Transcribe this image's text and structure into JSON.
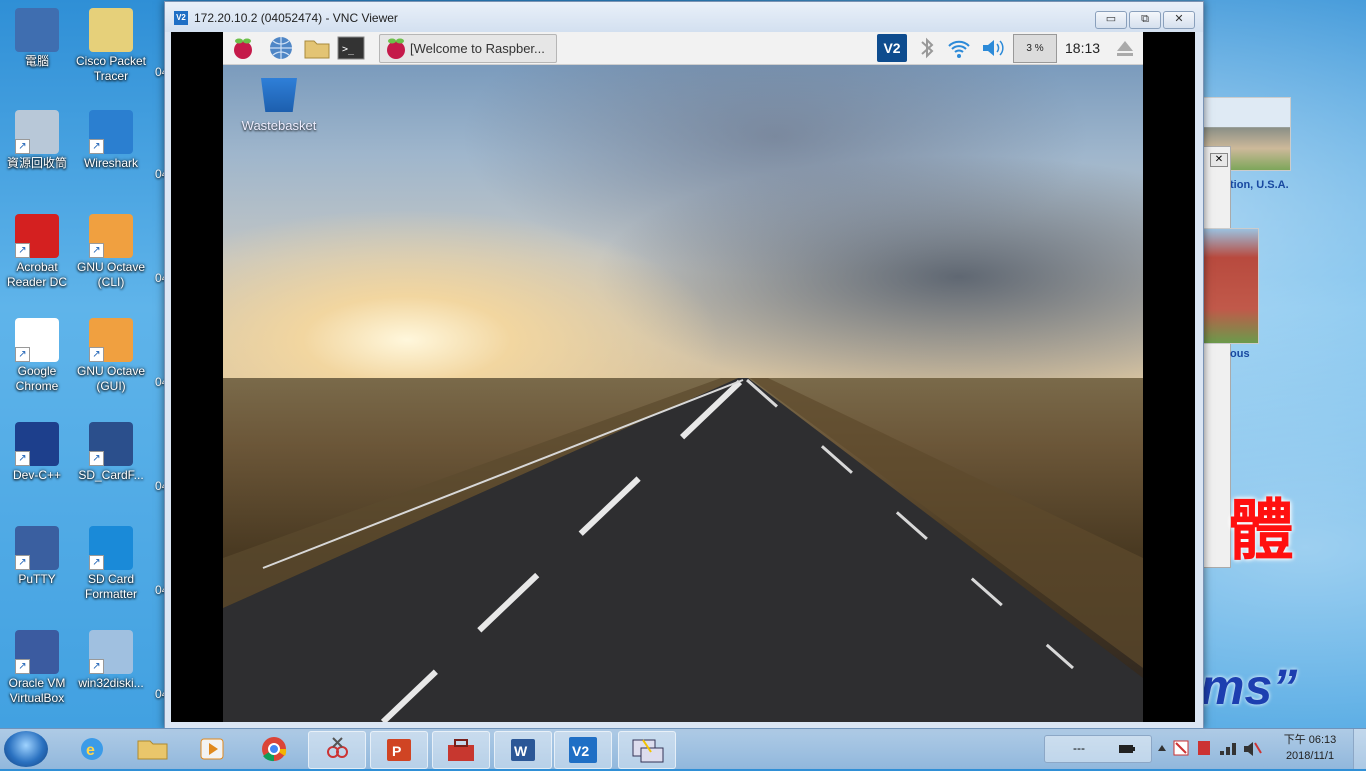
{
  "desktop": {
    "icons": [
      {
        "name": "computer-icon",
        "label": "電腦"
      },
      {
        "name": "cisco-packet-tracer-icon",
        "label": "Cisco Packet Tracer"
      },
      {
        "name": "recycle-bin-icon",
        "label": "資源回收筒"
      },
      {
        "name": "wireshark-icon",
        "label": "Wireshark"
      },
      {
        "name": "acrobat-reader-icon",
        "label": "Acrobat Reader DC"
      },
      {
        "name": "gnu-octave-cli-icon",
        "label": "GNU Octave (CLI)"
      },
      {
        "name": "google-chrome-icon",
        "label": "Google Chrome"
      },
      {
        "name": "gnu-octave-gui-icon",
        "label": "GNU Octave (GUI)"
      },
      {
        "name": "dev-cpp-icon",
        "label": "Dev-C++"
      },
      {
        "name": "sd-card-f-icon",
        "label": "SD_CardF..."
      },
      {
        "name": "putty-icon",
        "label": "PuTTY"
      },
      {
        "name": "sd-card-formatter-icon",
        "label": "SD Card Formatter"
      },
      {
        "name": "oracle-vm-virtualbox-icon",
        "label": "Oracle VM VirtualBox"
      },
      {
        "name": "win32diskimager-icon",
        "label": "win32diski..."
      }
    ],
    "truncated_label": "04",
    "bg_text": {
      "usa": "tion, U.S.A.",
      "campus": "ous",
      "big_red": "體",
      "big_blue": "ms”"
    }
  },
  "vnc": {
    "title": "172.20.10.2 (04052474) - VNC Viewer",
    "logo_text": "V2",
    "minimize": "▭",
    "restore": "⧉",
    "close": "✕"
  },
  "pi": {
    "task_label": "[Welcome to Raspber...",
    "vnc_label": "V2",
    "cpu": "3 %",
    "time": "18:13",
    "trash_label": "Wastebasket"
  },
  "taskbar": {
    "tray_text": "---",
    "clock_line1": "下午 06:13",
    "clock_line2": "2018/11/1"
  },
  "colors": {
    "pi_panel": "#f2f2f2",
    "vnc_accent": "#0e4c8e",
    "taskbar": "#9fbddf"
  }
}
